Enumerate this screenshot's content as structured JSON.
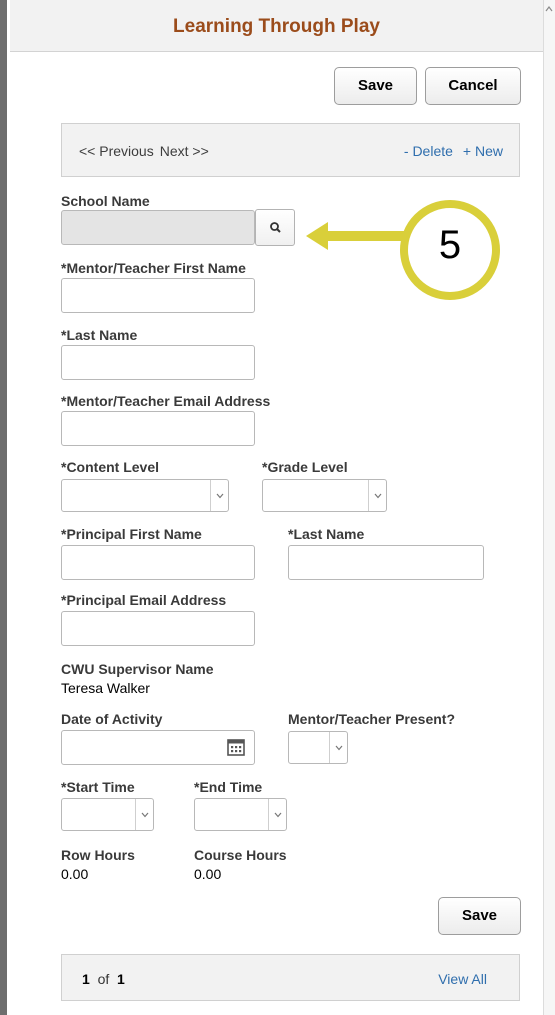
{
  "header": {
    "title": "Learning Through Play"
  },
  "toolbar": {
    "save_label": "Save",
    "cancel_label": "Cancel"
  },
  "nav": {
    "previous_label": "<< Previous",
    "next_label": "Next >>",
    "delete_label": "- Delete",
    "new_label": "+ New"
  },
  "form": {
    "school_name": {
      "label": "School Name",
      "value": ""
    },
    "mentor_first_name": {
      "label": "*Mentor/Teacher First Name",
      "value": ""
    },
    "last_name": {
      "label": "*Last Name",
      "value": ""
    },
    "mentor_email": {
      "label": "*Mentor/Teacher Email Address",
      "value": ""
    },
    "content_level": {
      "label": "*Content Level",
      "value": ""
    },
    "grade_level": {
      "label": "*Grade Level",
      "value": ""
    },
    "principal_first_name": {
      "label": "*Principal First Name",
      "value": ""
    },
    "principal_last_name": {
      "label": "*Last Name",
      "value": ""
    },
    "principal_email": {
      "label": "*Principal Email Address",
      "value": ""
    },
    "supervisor": {
      "label": "CWU Supervisor Name",
      "value": "Teresa Walker"
    },
    "date_of_activity": {
      "label": "Date of Activity",
      "value": ""
    },
    "mentor_present": {
      "label": "Mentor/Teacher Present?",
      "value": ""
    },
    "start_time": {
      "label": "*Start Time",
      "value": ""
    },
    "end_time": {
      "label": "*End Time",
      "value": ""
    },
    "row_hours": {
      "label": "Row Hours",
      "value": "0.00"
    },
    "course_hours": {
      "label": "Course Hours",
      "value": "0.00"
    }
  },
  "bottom": {
    "save_label": "Save"
  },
  "footer": {
    "current": "1",
    "of_label": "of",
    "total": "1",
    "view_all_label": "View All"
  },
  "annotation": {
    "number": "5",
    "color": "#d9cf3a"
  },
  "icons": {
    "lookup": "search-icon",
    "calendar": "calendar-icon",
    "dropdown": "chevron-down-icon"
  }
}
